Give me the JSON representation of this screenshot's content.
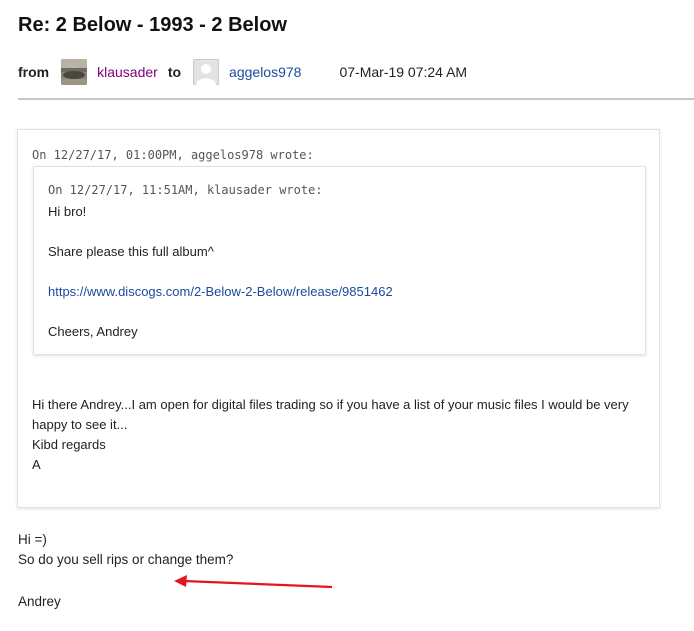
{
  "header": {
    "title": "Re: 2 Below - 1993 - 2 Below",
    "from_label": "from",
    "from_user": "klausader",
    "to_label": "to",
    "to_user": "aggelos978",
    "date": "07-Mar-19 07:24 AM"
  },
  "outer_quote": {
    "header": "On 12/27/17, 01:00PM, aggelos978 wrote:",
    "inner_quote": {
      "header": "On 12/27/17, 11:51AM, klausader wrote:",
      "lines": [
        "Hi bro!",
        "Share please this full album^",
        "https://www.discogs.com/2-Below-2-Below/release/9851462",
        "Cheers, Andrey"
      ]
    },
    "reply_lines": [
      "Hi there Andrey...I am open for digital files trading so if you have a list of your music files I would be very happy to see it...",
      "Kibd regards",
      "A"
    ]
  },
  "message": {
    "lines": [
      "Hi =)",
      "So do you sell rips or change them?",
      "Andrey"
    ]
  },
  "colors": {
    "link": "#1a4b9c",
    "visited_user": "#800080",
    "arrow": "#e8141b"
  }
}
